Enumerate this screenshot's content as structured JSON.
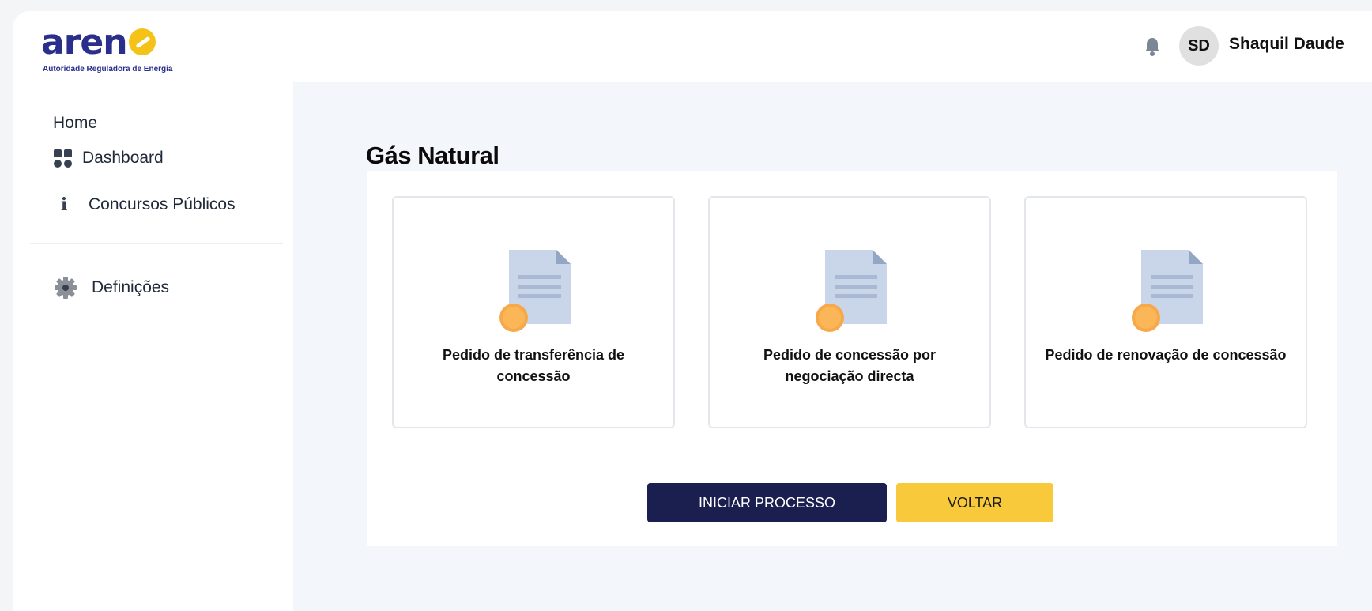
{
  "header": {
    "logo_text": "aren",
    "logo_subtitle": "Autoridade Reguladora de Energia",
    "avatar_initials": "SD",
    "user_name": "Shaquil Daude",
    "icons": {
      "notifications": "bell-icon"
    }
  },
  "sidebar": {
    "home_label": "Home",
    "items": [
      {
        "label": "Dashboard",
        "icon": "dashboard-grid-icon"
      },
      {
        "label": "Concursos Públicos",
        "icon": "info-icon"
      },
      {
        "label": "Definições",
        "icon": "gear-icon"
      }
    ]
  },
  "main": {
    "title": "Gás Natural",
    "cards": [
      {
        "label": "Pedido de transferência de concessão",
        "icon": "certificate-document-icon"
      },
      {
        "label": "Pedido de concessão por negociação directa",
        "icon": "certificate-document-icon"
      },
      {
        "label": "Pedido de renovação de concessão",
        "icon": "certificate-document-icon"
      }
    ],
    "buttons": {
      "primary": "INICIAR PROCESSO",
      "secondary": "VOLTAR"
    }
  },
  "colors": {
    "brand_navy": "#1a1f4f",
    "brand_yellow": "#f8c93a",
    "logo_blue": "#2b2f8c",
    "document_blue": "#c9d6ea",
    "seal_orange": "#f7a94a"
  }
}
